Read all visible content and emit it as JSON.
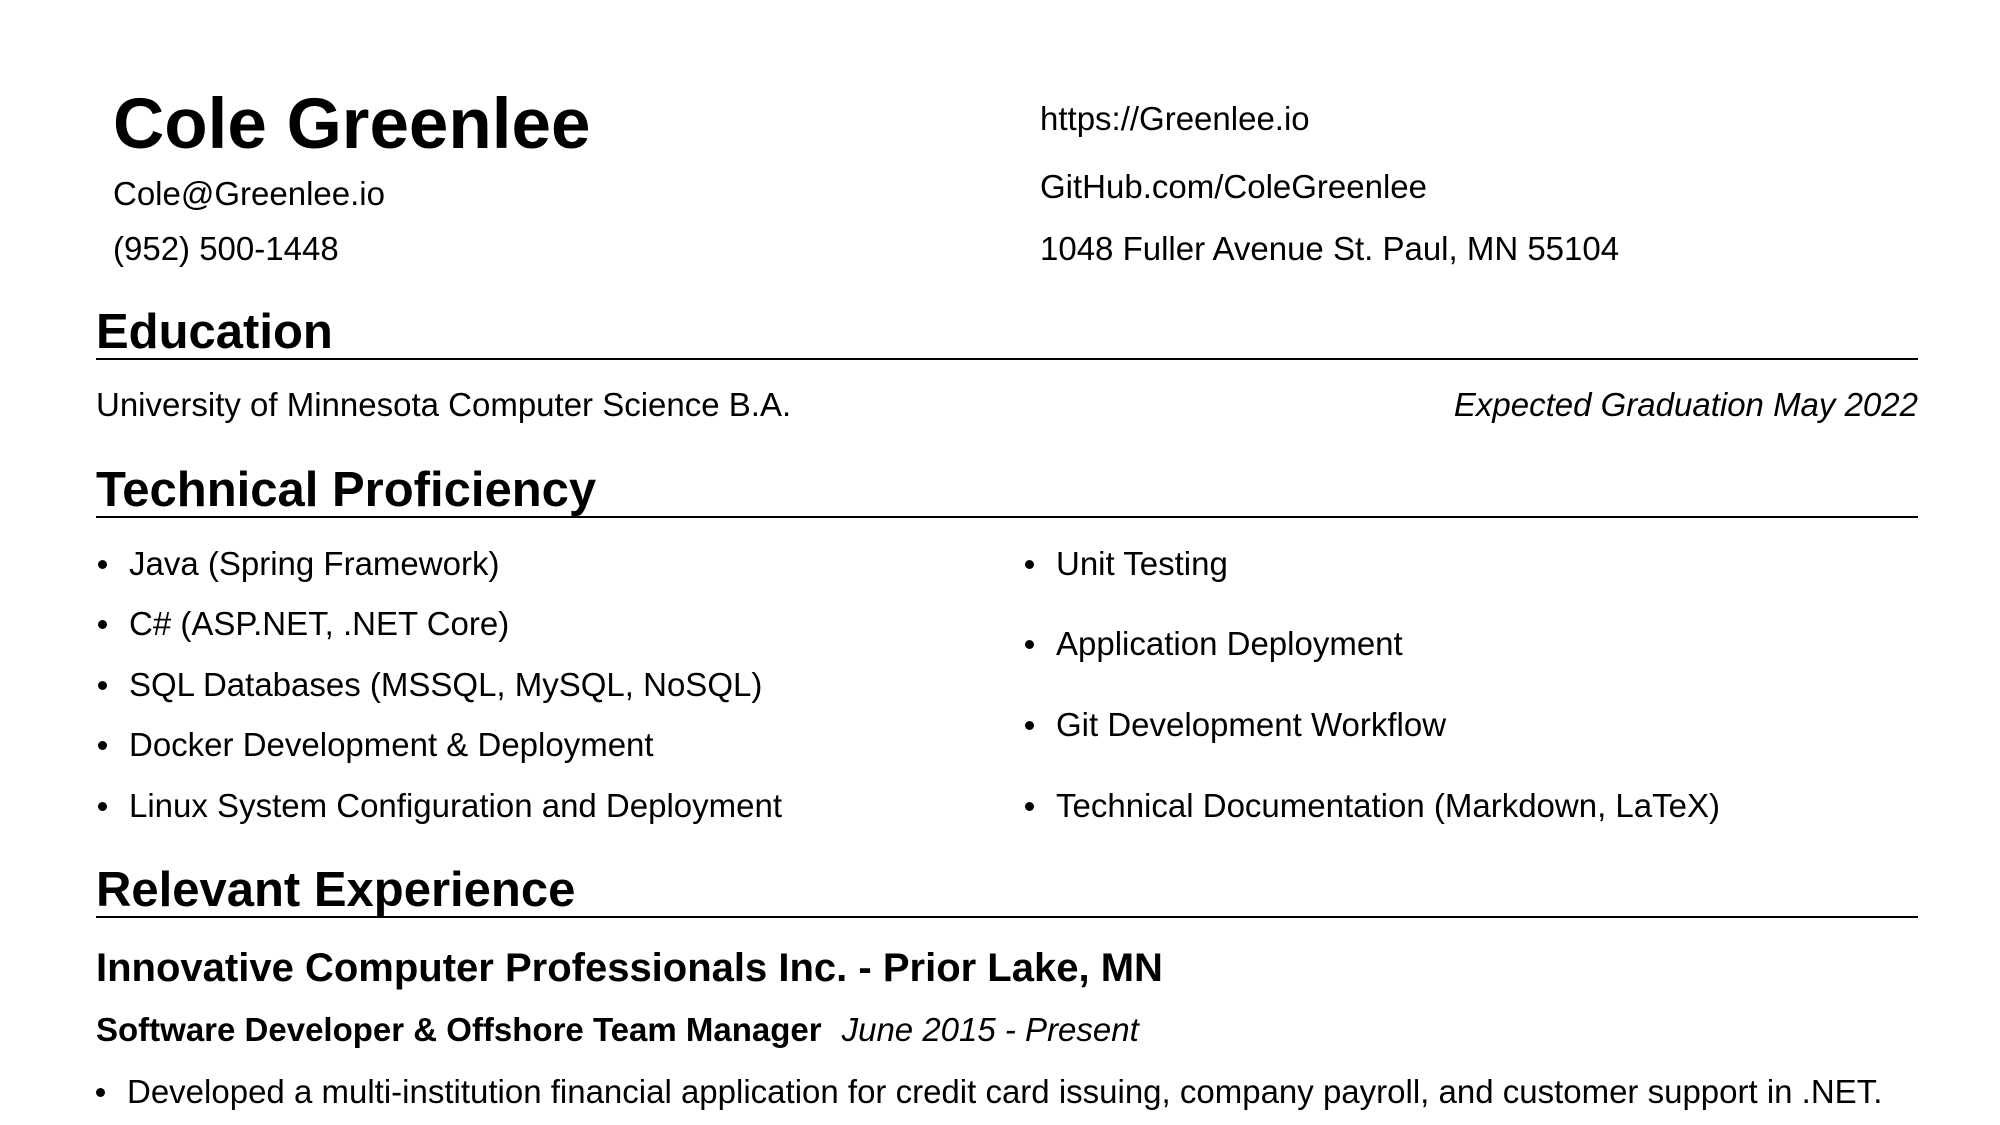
{
  "header": {
    "name": "Cole Greenlee",
    "email": "Cole@Greenlee.io",
    "phone": "(952) 500-1448",
    "website": "https://Greenlee.io",
    "github": "GitHub.com/ColeGreenlee",
    "address": "1048 Fuller Avenue St. Paul, MN 55104"
  },
  "education": {
    "title": "Education",
    "degree": "University of Minnesota Computer Science B.A.",
    "date": "Expected Graduation May 2022"
  },
  "skills": {
    "title": "Technical Proficiency",
    "left": [
      "Java (Spring Framework)",
      "C# (ASP.NET, .NET Core)",
      "SQL Databases (MSSQL, MySQL, NoSQL)",
      "Docker Development & Deployment",
      "Linux System Configuration and Deployment"
    ],
    "right": [
      "Unit Testing",
      "Application Deployment",
      "Git Development Workflow",
      "Technical Documentation (Markdown, LaTeX)"
    ]
  },
  "experience": {
    "title": "Relevant Experience",
    "company": "Innovative Computer Professionals Inc. - Prior Lake, MN",
    "role": "Software Developer & Offshore Team Manager",
    "dates": "June 2015 - Present",
    "bullets": [
      "Developed a multi-institution financial application for credit card issuing, company payroll, and customer support in .NET."
    ]
  }
}
